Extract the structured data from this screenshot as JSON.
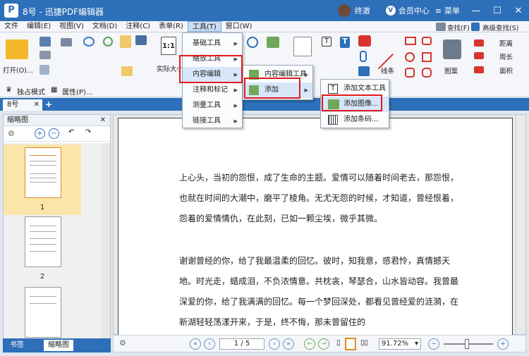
{
  "titlebar": {
    "title": "8号 - 迅捷PDF编辑器",
    "app_icon": "P",
    "username": "终澈",
    "vip_badge": "V",
    "member_center": "会员中心",
    "menu": "菜单",
    "minimize": "—",
    "maximize": "☐",
    "close": "✕"
  },
  "menubar": [
    "文件",
    "编辑(E)",
    "视图(V)",
    "文档(D)",
    "注释(C)",
    "表单(R)",
    "工具(T)",
    "窗口(W)"
  ],
  "ribbon": {
    "open": "打开(O)...",
    "actual_size": "实际大小",
    "exclusive_mode": "独占模式",
    "properties": "属性(P)...",
    "line": "线条",
    "pattern": "图案",
    "search": "查找(F)",
    "advanced_search": "高级查找(S)",
    "distance": "距离",
    "perimeter": "周长",
    "area": "面积",
    "actual_size_icon": "1:1"
  },
  "doc_tab": "8号",
  "side_panel": {
    "title": "缩略图",
    "pages": [
      "1",
      "2"
    ],
    "tabs": [
      "书签",
      "缩略图"
    ]
  },
  "document": {
    "paragraphs": [
      "上心头，当初的怨恨，成了生命的主题。爱情可以随着时间老去，那怨恨，也就在时间的大潮中，磨平了棱角。无尤无怨的时候，才知道，曾经恨着，怨着的爱情情仇，在此刻，已如一颗尘埃，微乎其微。",
      "谢谢曾经的你，给了我最温柔的回忆。彼时，知我意，感君怜，真情撼天地。时光走，蜡成泪，不负浓情意。共枕衾，琴瑟合，山水皆动容。我曾最深爱的你，给了我满满的回忆。每一个梦回深处，都看见曾经爱的涟漪，在新湖轻轻荡漾开来，于是，终不悔，那未曾留住的"
    ]
  },
  "statusbar": {
    "page_input": "1 / 5",
    "zoom": "91.72%"
  },
  "tools_menu": {
    "items": [
      "基础工具",
      "缩放工具",
      "内容编辑",
      "注释和标记",
      "测量工具",
      "链接工具"
    ]
  },
  "content_edit_menu": {
    "items": [
      "内容编辑工具",
      "添加"
    ]
  },
  "add_menu": {
    "items": [
      "添加文本工具",
      "添加图像...",
      "添加条码..."
    ]
  }
}
